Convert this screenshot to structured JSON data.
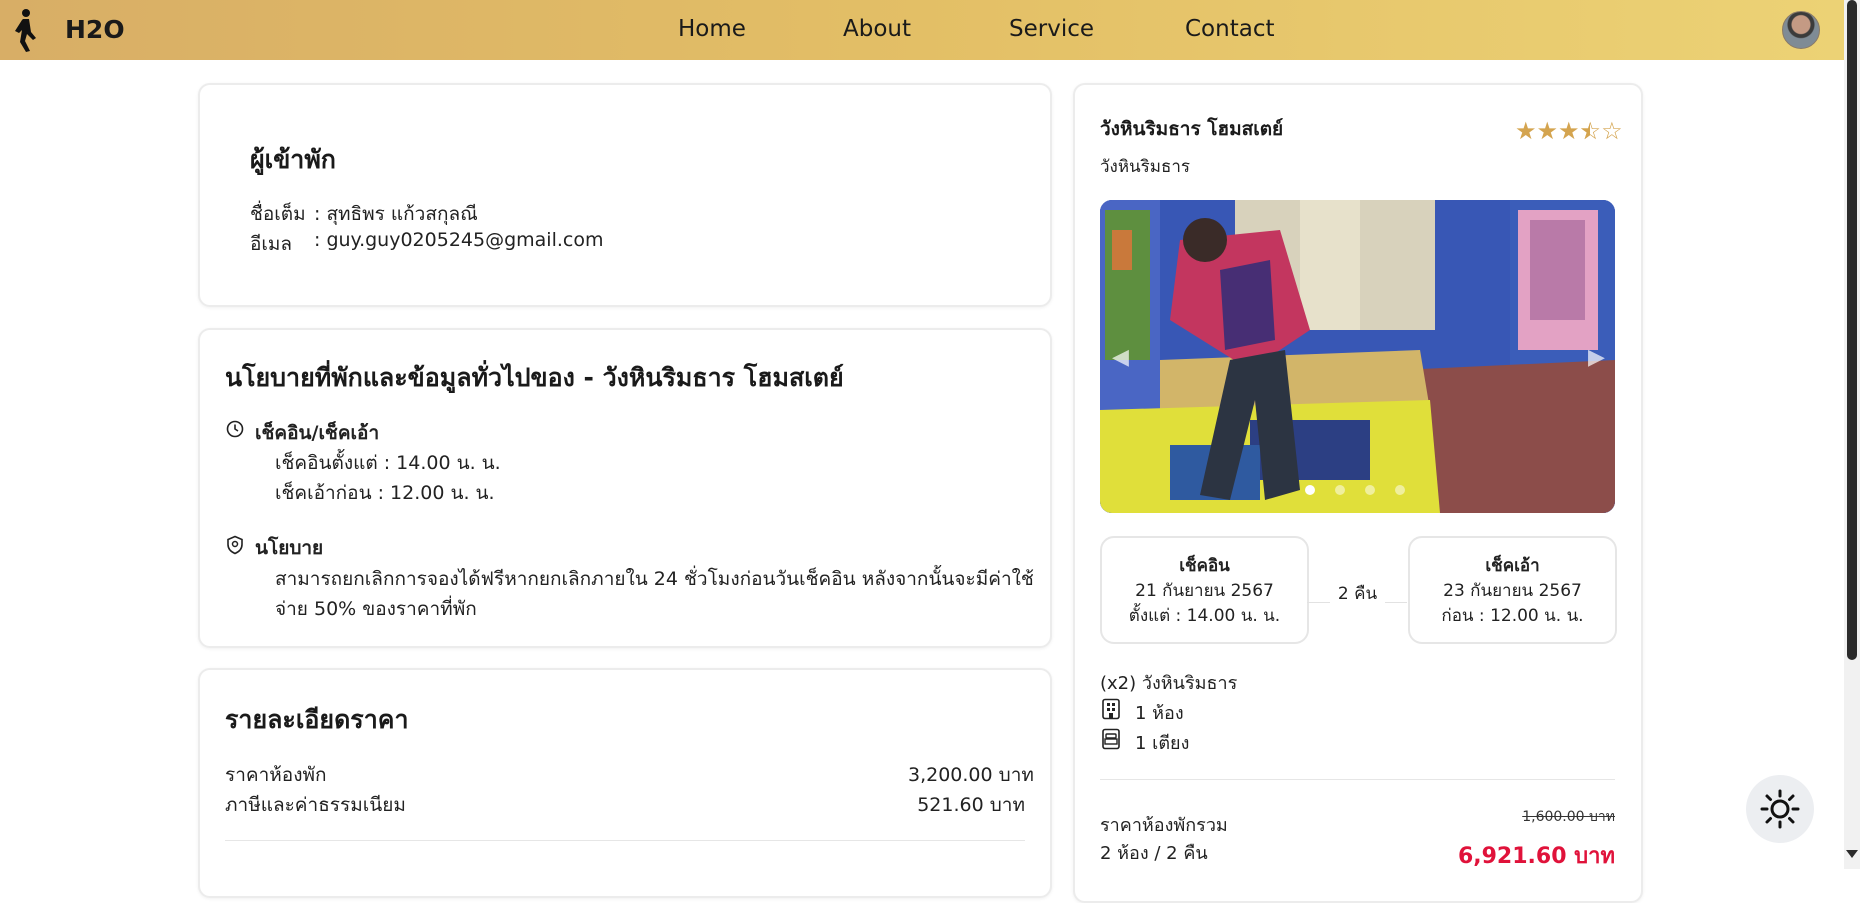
{
  "navbar": {
    "brand": "H2O",
    "links": [
      "Home",
      "About",
      "Service",
      "Contact"
    ]
  },
  "guest": {
    "title": "ผู้เข้าพัก",
    "name_label": "ชื่อเต็ม",
    "name_value": ": สุทธิพร แก้วสกุลณี",
    "email_label": "อีเมล",
    "email_value": ": guy.guy0205245@gmail.com"
  },
  "policy": {
    "title": "นโยบายที่พักและข้อมูลทั่วไปของ - วังหินริมธาร โฮมสเตย์",
    "checkin_heading": "เช็คอิน/เช็คเอ้า",
    "checkin_line": "เช็คอินตั้งแต่ : 14.00 น. น.",
    "checkout_line": "เช็คเอ้าก่อน : 12.00 น. น.",
    "policy_heading": "นโยบาย",
    "policy_line1": "สามารถยกเลิกการจองได้ฟรีหากยกเลิกภายใน 24 ชั่วโมงก่อนวันเช็คอิน หลังจากนั้นจะมีค่าใช้",
    "policy_line2": "จ่าย 50% ของราคาที่พัก"
  },
  "price": {
    "title": "รายละเอียดราคา",
    "room_label": "ราคาห้องพัก",
    "room_value": "3,200.00 บาท",
    "tax_label": "ภาษีและค่าธรรมเนียม",
    "tax_value": "521.60 บาท"
  },
  "hotel": {
    "name": "วังหินริมธาร โฮมสเตย์",
    "location": "วังหินริมธาร",
    "rating": 3.5,
    "rating_max": 5,
    "carousel_dots": 4,
    "carousel_active": 1,
    "checkin_title": "เช็คอิน",
    "checkin_date": "21 กันยายน 2567",
    "checkin_time": "ตั้งแต่ : 14.00 น. น.",
    "nights": "2 คืน",
    "checkout_title": "เช็คเอ้า",
    "checkout_date": "23 กันยายน 2567",
    "checkout_time": "ก่อน : 12.00 น. น.",
    "room_type": "(x2) วังหินริมธาร",
    "rooms": "1 ห้อง",
    "beds": "1 เตียง",
    "total_label": "ราคาห้องพักรวม",
    "total_sub": "2 ห้อง / 2 คืน",
    "original_price": "1,600.00 บาท",
    "total_price": "6,921.60 บาท"
  },
  "colors": {
    "accent_gold": "#d8ae66",
    "star": "#d4a44f",
    "price_red": "#e0123a"
  }
}
